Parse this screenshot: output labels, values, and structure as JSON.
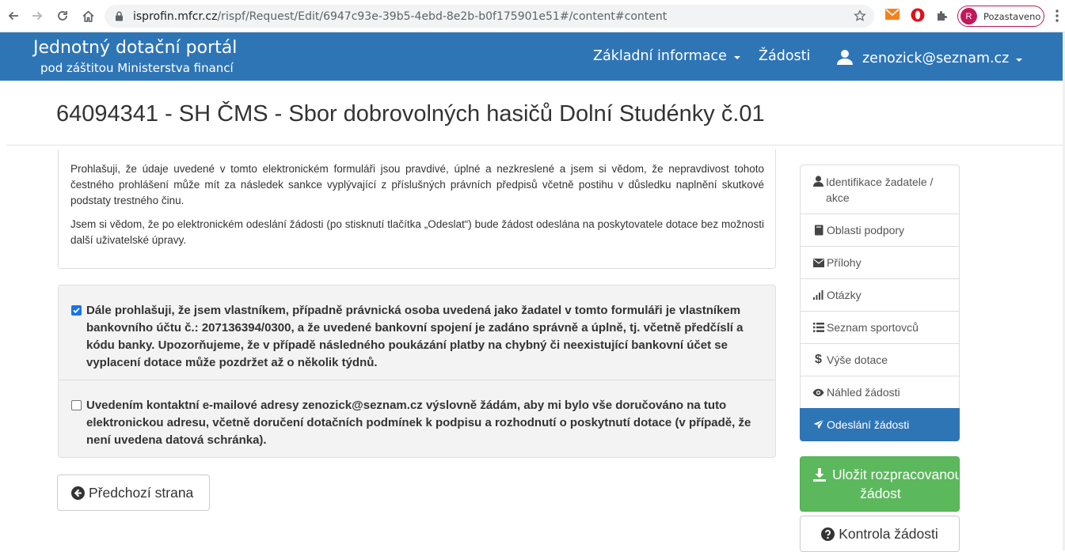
{
  "browser": {
    "url_host": "isprofin.mfcr.cz",
    "url_path": "/rispf/Request/Edit/6947c93e-39b5-4ebd-8e2b-b0f175901e51#/content#content",
    "profile_initial": "R",
    "profile_label": "Pozastaveno"
  },
  "navbar": {
    "brand_title": "Jednotný dotační portál",
    "brand_subtitle": "pod záštitou Ministerstva financí",
    "menu_info": "Základní informace",
    "menu_requests": "Žádosti",
    "user_email": "zenozick@seznam.cz"
  },
  "page_title": "64094341 - SH ČMS - Sbor dobrovolných hasičů Dolní Studénky č.01",
  "declaration": {
    "p1": "Prohlašuji, že údaje uvedené v tomto elektronickém formuláři jsou pravdivé, úplné a nezkreslené a jsem si vědom, že nepravdivost tohoto čestného prohlášení může mít za následek sankce vyplývající z příslušných právních předpisů včetně postihu v důsledku naplnění skutkové podstaty trestného činu.",
    "p2": "Jsem si vědom, že po elektronickém odeslání žádosti (po stisknutí tlačítka „Odeslat“) bude žádost odeslána na poskytovatele dotace bez možnosti další uživatelské úpravy."
  },
  "checkboxes": [
    {
      "checked": true,
      "text": "Dále prohlašuji, že jsem vlastníkem, případně právnická osoba uvedená jako žadatel v tomto formuláři je vlastníkem bankovního účtu č.: 207136394/0300, a že uvedené bankovní spojení je zadáno správně a úplně, tj. včetně předčíslí a kódu banky. Upozorňujeme, že v případě následného poukázání platby na chybný či neexistující bankovní účet se vyplacení dotace může pozdržet až o několik týdnů."
    },
    {
      "checked": false,
      "text": "Uvedením kontaktní e-mailové adresy zenozick@seznam.cz výslovně žádám, aby mi bylo vše doručováno na tuto elektronickou adresu, včetně doručení dotačních podmínek k podpisu a rozhodnutí o poskytnutí dotace (v případě, že není uvedena datová schránka)."
    }
  ],
  "prev_button": "Předchozí strana",
  "side_menu": [
    {
      "label": "Identifikace žadatele / akce",
      "icon": "user-icon",
      "active": false
    },
    {
      "label": "Oblasti podpory",
      "icon": "book-icon",
      "active": false
    },
    {
      "label": "Přílohy",
      "icon": "envelope-icon",
      "active": false
    },
    {
      "label": "Otázky",
      "icon": "signal-icon",
      "active": false
    },
    {
      "label": "Seznam sportovců",
      "icon": "list-icon",
      "active": false
    },
    {
      "label": "Výše dotace",
      "icon": "dollar-icon",
      "active": false
    },
    {
      "label": "Náhled žádosti",
      "icon": "eye-icon",
      "active": false
    },
    {
      "label": "Odeslání žádosti",
      "icon": "send-icon",
      "active": true
    }
  ],
  "save_button": {
    "line1": "Uložit rozpracovanou",
    "line2": "žádost"
  },
  "check_button": "Kontrola žádosti",
  "colors": {
    "primary": "#2e75b6",
    "success": "#5cb85c"
  }
}
